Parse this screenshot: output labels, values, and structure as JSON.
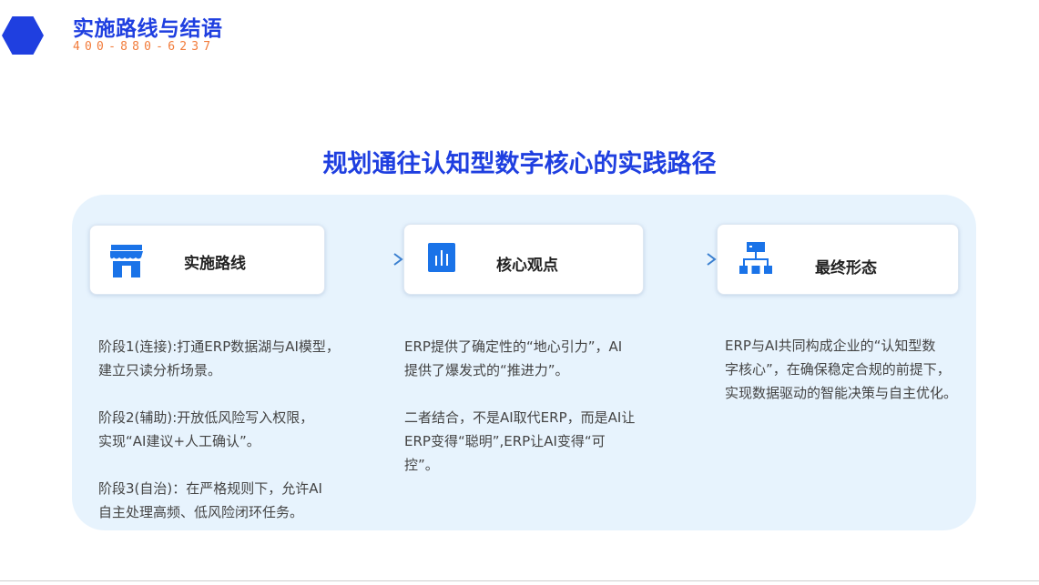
{
  "header": {
    "title": "实施路线与结语",
    "phone": "400-880-6237"
  },
  "main_title": "规划通往认知型数字核心的实践路径",
  "cards": [
    {
      "title": "实施路线",
      "icon": "store-icon"
    },
    {
      "title": "核心观点",
      "icon": "bar-chart-icon"
    },
    {
      "title": "最终形态",
      "icon": "org-chart-icon"
    }
  ],
  "columns": {
    "route": {
      "p1_l1": "阶段1(连接):打通ERP数据湖与AI模型，",
      "p1_l2": "建立只读分析场景。",
      "p2_l1": "阶段2(辅助):开放低风险写入权限，",
      "p2_l2": "实现“AI建议+人工确认”。",
      "p3_l1": "阶段3(自治)：在严格规则下，允许AI",
      "p3_l2": "自主处理高频、低风险闭环任务。"
    },
    "view": {
      "p1_l1": "ERP提供了确定性的“地心引力”，AI",
      "p1_l2": "提供了爆发式的“推进力”。",
      "p2_l1": "二者结合，不是AI取代ERP，而是AI让",
      "p2_l2": "ERP变得“聪明”,ERP让AI变得“可",
      "p2_l3": "控”。"
    },
    "final": {
      "l1": "ERP与AI共同构成企业的“认知型数",
      "l2": "字核心”，在确保稳定合规的前提下，",
      "l3": "实现数据驱动的智能决策与自主优化。"
    }
  },
  "colors": {
    "brand_blue": "#1f3fe0",
    "phone_orange": "#f27b3a",
    "panel_bg": "#e7f3fd",
    "arrow_start": "#36c0a0",
    "arrow_end": "#3a7fd0"
  }
}
